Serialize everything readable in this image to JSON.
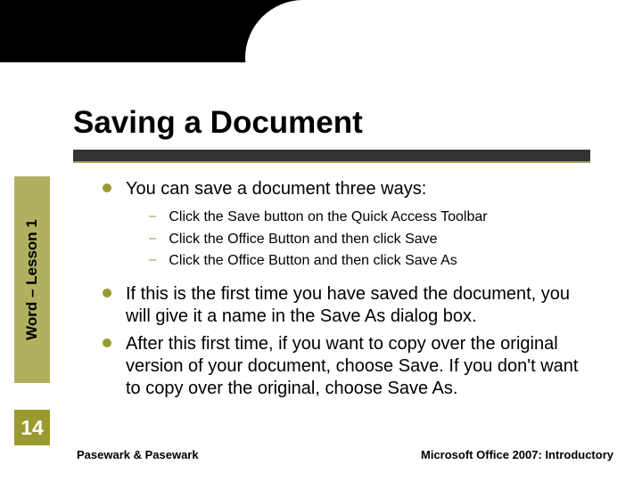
{
  "title": "Saving a Document",
  "sidebar_label": "Word – Lesson 1",
  "page_number": "14",
  "footer": {
    "left": "Pasewark & Pasewark",
    "right": "Microsoft Office 2007:  Introductory"
  },
  "bullets": {
    "b1": "You can save a document three ways:",
    "sub1": "Click the Save button on the Quick Access Toolbar",
    "sub2": "Click the Office Button and then click Save",
    "sub3": "Click the Office Button and then click Save As",
    "b2": "If this is the first time you have saved the document, you will give it a name in the Save As dialog box.",
    "b3": "After this first time, if you want to copy over the original version of your document, choose Save.  If you don't want to copy over the original, choose Save As."
  }
}
